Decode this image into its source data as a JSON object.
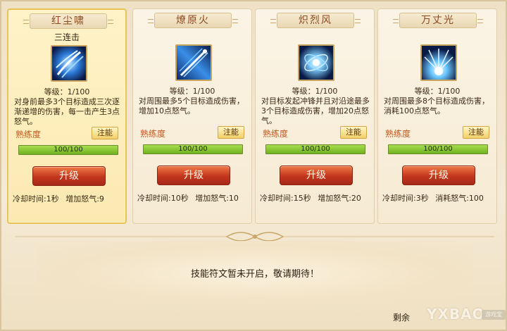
{
  "skills": [
    {
      "name": "红尘啸",
      "subtitle": "三连击",
      "level_text": "等级：1/100",
      "description": "对身前最多3个目标造成三次逐渐递增的伤害，每一击产生3点怒气。",
      "proficiency_label": "熟练度",
      "inject_label": "注能",
      "progress_text": "100/100",
      "progress_fraction": 1.0,
      "upgrade_label": "升级",
      "cooldown": "冷却时间:1秒",
      "rage": "增加怒气:9",
      "selected": true,
      "icon": "claw-slash-icon"
    },
    {
      "name": "燎原火",
      "subtitle": "",
      "level_text": "等级：1/100",
      "description": "对周围最多5个目标造成伤害，增加10点怒气。",
      "proficiency_label": "熟练度",
      "inject_label": "注能",
      "progress_text": "100/100",
      "progress_fraction": 1.0,
      "upgrade_label": "升级",
      "cooldown": "冷却时间:10秒",
      "rage": "增加怒气:10",
      "selected": false,
      "icon": "sword-strike-icon"
    },
    {
      "name": "炽烈风",
      "subtitle": "",
      "level_text": "等级：1/100",
      "description": "对目标发起冲锋并且对沿途最多3个目标造成伤害，增加20点怒气。",
      "proficiency_label": "熟练度",
      "inject_label": "注能",
      "progress_text": "100/100",
      "progress_fraction": 1.0,
      "upgrade_label": "升级",
      "cooldown": "冷却时间:15秒",
      "rage": "增加怒气:20",
      "selected": false,
      "icon": "whirlwind-icon"
    },
    {
      "name": "万丈光",
      "subtitle": "",
      "level_text": "等级：1/100",
      "description": "对周围最多8个目标造成伤害，消耗100点怒气。",
      "proficiency_label": "熟练度",
      "inject_label": "注能",
      "progress_text": "100/100",
      "progress_fraction": 1.0,
      "upgrade_label": "升级",
      "cooldown": "冷却时间:3秒",
      "rage": "消耗怒气:100",
      "selected": false,
      "icon": "light-burst-icon"
    }
  ],
  "notice": "技能符文暂未开启，敬请期待！",
  "remaining_label": "剩余",
  "watermark": {
    "brand": "游戏宝",
    "text": "YXBAO"
  },
  "colors": {
    "title": "#8a4a22",
    "progress": "#7cc22c",
    "upgrade": "#c2361c",
    "inject": "#f2cf6a",
    "proficiency": "#c0581c"
  }
}
